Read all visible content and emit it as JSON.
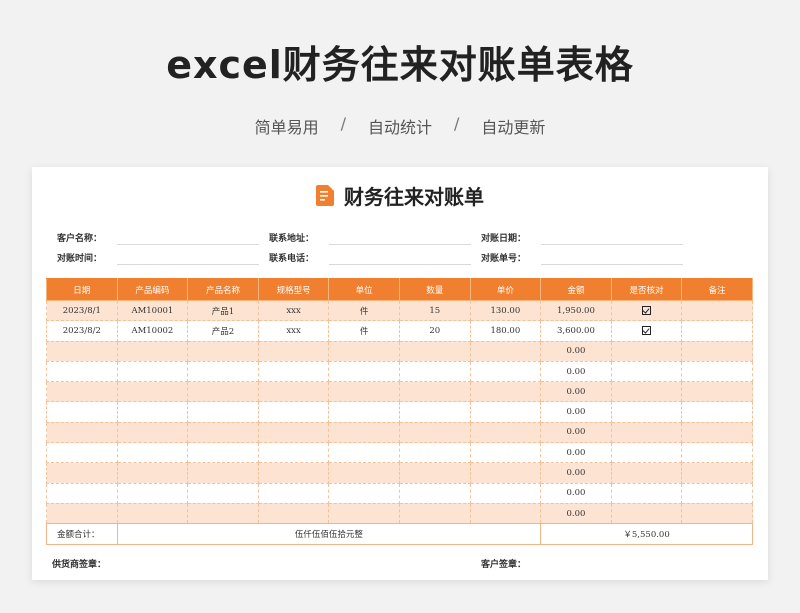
{
  "header": {
    "title": "excel财务往来对账单表格",
    "features": [
      "简单易用",
      "自动统计",
      "自动更新"
    ],
    "separator": "/"
  },
  "sheet": {
    "title": "财务往来对账单",
    "icon": "document-icon",
    "info": {
      "customer_name": "客户名称：",
      "contact_address": "联系地址：",
      "statement_date": "对账日期：",
      "statement_time": "对账时间：",
      "contact_phone": "联系电话：",
      "statement_no": "对账单号："
    },
    "columns": [
      "日期",
      "产品编码",
      "产品名称",
      "规格型号",
      "单位",
      "数量",
      "单价",
      "金额",
      "是否核对",
      "备注"
    ],
    "rows": [
      {
        "date": "2023/8/1",
        "code": "AM10001",
        "name": "产品1",
        "spec": "xxx",
        "unit": "件",
        "qty": "15",
        "price": "130.00",
        "amount": "1,950.00",
        "checked": true,
        "note": ""
      },
      {
        "date": "2023/8/2",
        "code": "AM10002",
        "name": "产品2",
        "spec": "xxx",
        "unit": "件",
        "qty": "20",
        "price": "180.00",
        "amount": "3,600.00",
        "checked": true,
        "note": ""
      },
      {
        "date": "",
        "code": "",
        "name": "",
        "spec": "",
        "unit": "",
        "qty": "",
        "price": "",
        "amount": "0.00",
        "checked": false,
        "note": ""
      },
      {
        "date": "",
        "code": "",
        "name": "",
        "spec": "",
        "unit": "",
        "qty": "",
        "price": "",
        "amount": "0.00",
        "checked": false,
        "note": ""
      },
      {
        "date": "",
        "code": "",
        "name": "",
        "spec": "",
        "unit": "",
        "qty": "",
        "price": "",
        "amount": "0.00",
        "checked": false,
        "note": ""
      },
      {
        "date": "",
        "code": "",
        "name": "",
        "spec": "",
        "unit": "",
        "qty": "",
        "price": "",
        "amount": "0.00",
        "checked": false,
        "note": ""
      },
      {
        "date": "",
        "code": "",
        "name": "",
        "spec": "",
        "unit": "",
        "qty": "",
        "price": "",
        "amount": "0.00",
        "checked": false,
        "note": ""
      },
      {
        "date": "",
        "code": "",
        "name": "",
        "spec": "",
        "unit": "",
        "qty": "",
        "price": "",
        "amount": "0.00",
        "checked": false,
        "note": ""
      },
      {
        "date": "",
        "code": "",
        "name": "",
        "spec": "",
        "unit": "",
        "qty": "",
        "price": "",
        "amount": "0.00",
        "checked": false,
        "note": ""
      },
      {
        "date": "",
        "code": "",
        "name": "",
        "spec": "",
        "unit": "",
        "qty": "",
        "price": "",
        "amount": "0.00",
        "checked": false,
        "note": ""
      },
      {
        "date": "",
        "code": "",
        "name": "",
        "spec": "",
        "unit": "",
        "qty": "",
        "price": "",
        "amount": "0.00",
        "checked": false,
        "note": ""
      }
    ],
    "total": {
      "label": "金额合计：",
      "in_words": "伍仟伍佰伍拾元整",
      "amount": "￥5,550.00"
    },
    "supplier_signature": "供货商签章：",
    "customer_signature": "客户签章："
  },
  "colors": {
    "accent": "#f07f2f",
    "row_shade": "#fde4d2"
  }
}
